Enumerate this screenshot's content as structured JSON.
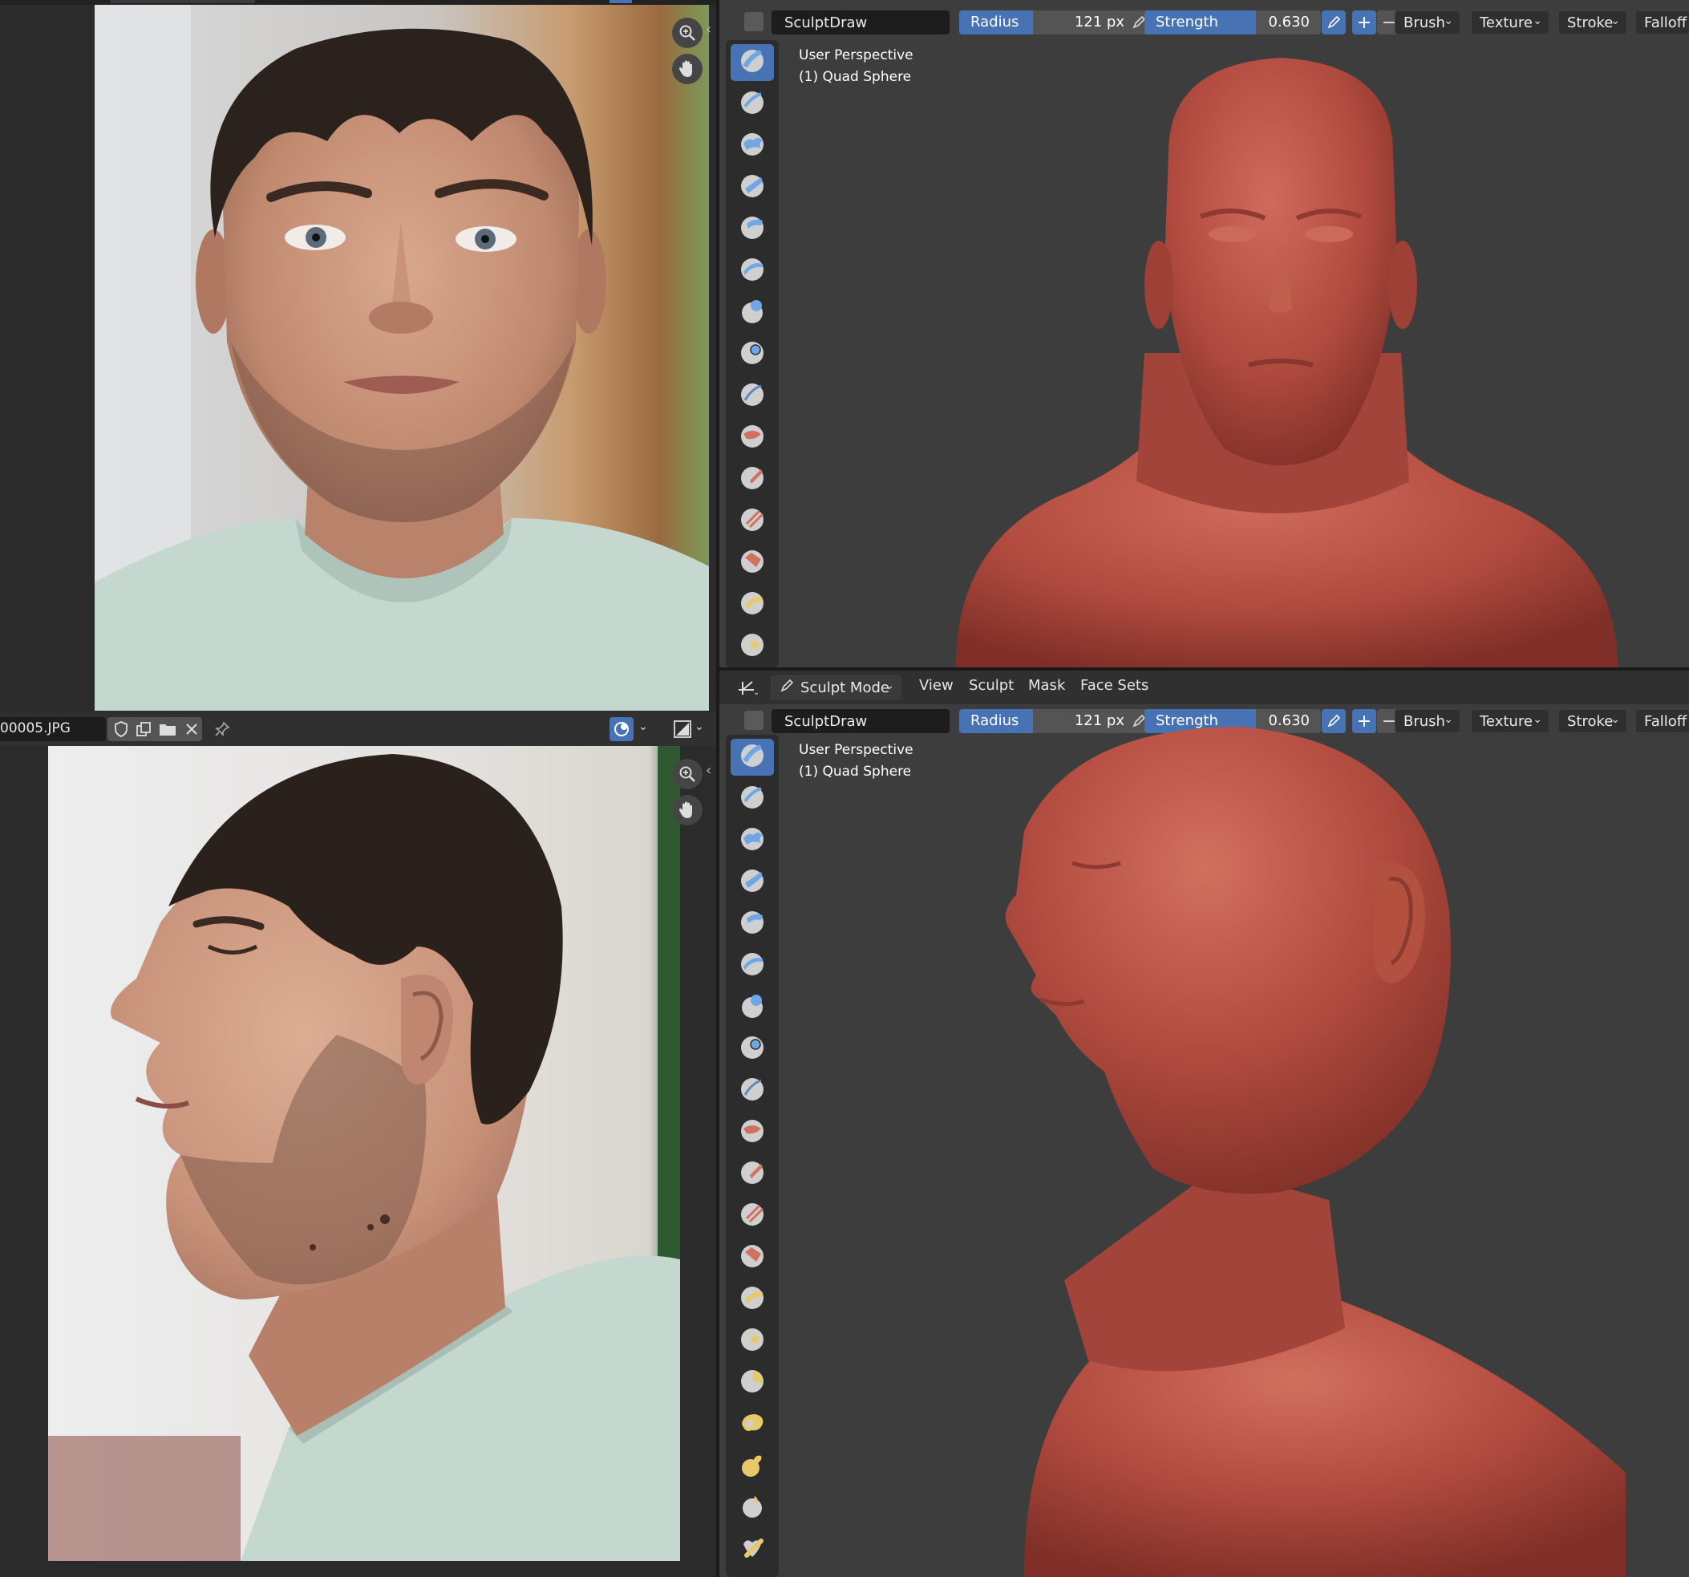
{
  "image_editor_bottom": {
    "filename": "00005.JPG"
  },
  "viewport_header": {
    "mode_label": "Sculpt Mode",
    "menus": [
      "View",
      "Sculpt",
      "Mask",
      "Face Sets"
    ]
  },
  "tool_settings": {
    "brush_name": "SculptDraw",
    "radius_label": "Radius",
    "radius_value": "121 px",
    "radius_fraction": 0.42,
    "strength_label": "Strength",
    "strength_value": "0.630",
    "strength_fraction": 0.63,
    "dropdowns": [
      "Brush",
      "Texture",
      "Stroke",
      "Falloff"
    ]
  },
  "viewport_overlay": {
    "view_name": "User Perspective",
    "object_name": "(1) Quad Sphere"
  },
  "colors": {
    "accent_blue": "#4772b3",
    "sculpt_clay": "#b04a3e",
    "viewport_bg": "#3d3d3d",
    "panel_bg": "#2b2b2b"
  },
  "tool_icons_top": [
    "draw",
    "draw-sharp",
    "clay",
    "clay-strips",
    "clay-thumb",
    "layer",
    "inflate",
    "blob",
    "crease",
    "smooth",
    "flatten",
    "fill",
    "scrape",
    "multiplane-scrape",
    "pinch"
  ],
  "tool_icons_bottom": [
    "draw",
    "draw-sharp",
    "clay",
    "clay-strips",
    "clay-thumb",
    "layer",
    "inflate",
    "blob",
    "crease",
    "smooth",
    "flatten",
    "fill",
    "scrape",
    "multiplane-scrape",
    "pinch",
    "grab",
    "elastic-deform",
    "snake-hook",
    "thumb",
    "pose"
  ]
}
